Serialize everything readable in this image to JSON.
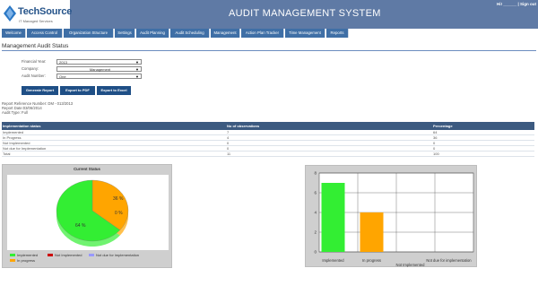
{
  "header": {
    "logo_text": "TechSource",
    "logo_sub": "IT Managed Services",
    "app_title": "AUDIT MANAGEMENT SYSTEM",
    "user_link": "Hi! ______ | Sign out"
  },
  "nav": {
    "tabs": [
      "Welcome",
      "Access Control",
      "Organization Structure",
      "Settings",
      "Audit Planning",
      "Audit Scheduling",
      "Management",
      "Action Plan Tracker",
      "Time Management",
      "Reports"
    ]
  },
  "page": {
    "title": "Management Audit Status"
  },
  "form": {
    "financial_year": {
      "label": "Financial Year:",
      "value": "2013"
    },
    "company": {
      "label": "Company:",
      "value": "Management"
    },
    "audit_number": {
      "label": "Audit Number:",
      "value": "One"
    }
  },
  "buttons": {
    "generate": "Generate Report",
    "export_pdf": "Export to PDF",
    "export_excel": "Export to Excel"
  },
  "report_meta": {
    "reference": "Report Reference Number: DM - 013/2013",
    "date": "Report Date:03/06/2014",
    "type": "Audit Type: Full"
  },
  "table": {
    "headers": [
      "Implementation status",
      "No of observations",
      "Percentage"
    ],
    "rows": [
      [
        "Implemented",
        "7",
        "64"
      ],
      [
        "In Progress",
        "4",
        "36"
      ],
      [
        "Not Implemented",
        "0",
        "0"
      ],
      [
        "Not due for Implementation",
        "0",
        "0"
      ],
      [
        "Total",
        "11",
        "100"
      ]
    ]
  },
  "colors": {
    "header_bg": "#5f7aa5",
    "nav_tab": "#3f6fa6",
    "button": "#1f4f86",
    "implemented": "#33ee33",
    "in_progress": "#ffa500",
    "not_implemented": "#cc0000",
    "not_due": "#9999ff"
  },
  "chart_data": [
    {
      "type": "pie",
      "title": "Current Status",
      "categories": [
        "Implemented",
        "Not Implemented",
        "Not due for implementation",
        "In progress"
      ],
      "values": [
        64,
        0,
        0,
        36
      ],
      "slice_labels": [
        "64 %",
        "0 %",
        "0 %",
        "36 %"
      ],
      "legend": [
        "Implemented",
        "Not Implemented",
        "Not due for implementation",
        "In progress"
      ],
      "legend_position": "bottom"
    },
    {
      "type": "bar",
      "categories": [
        "Implemented",
        "In progress",
        "Not Implemented",
        "Not due for implementation"
      ],
      "values": [
        7,
        4,
        0,
        0
      ],
      "ylim": [
        0,
        8
      ],
      "yticks": [
        "0",
        "2",
        "4",
        "6",
        "8"
      ],
      "grid": true
    }
  ]
}
